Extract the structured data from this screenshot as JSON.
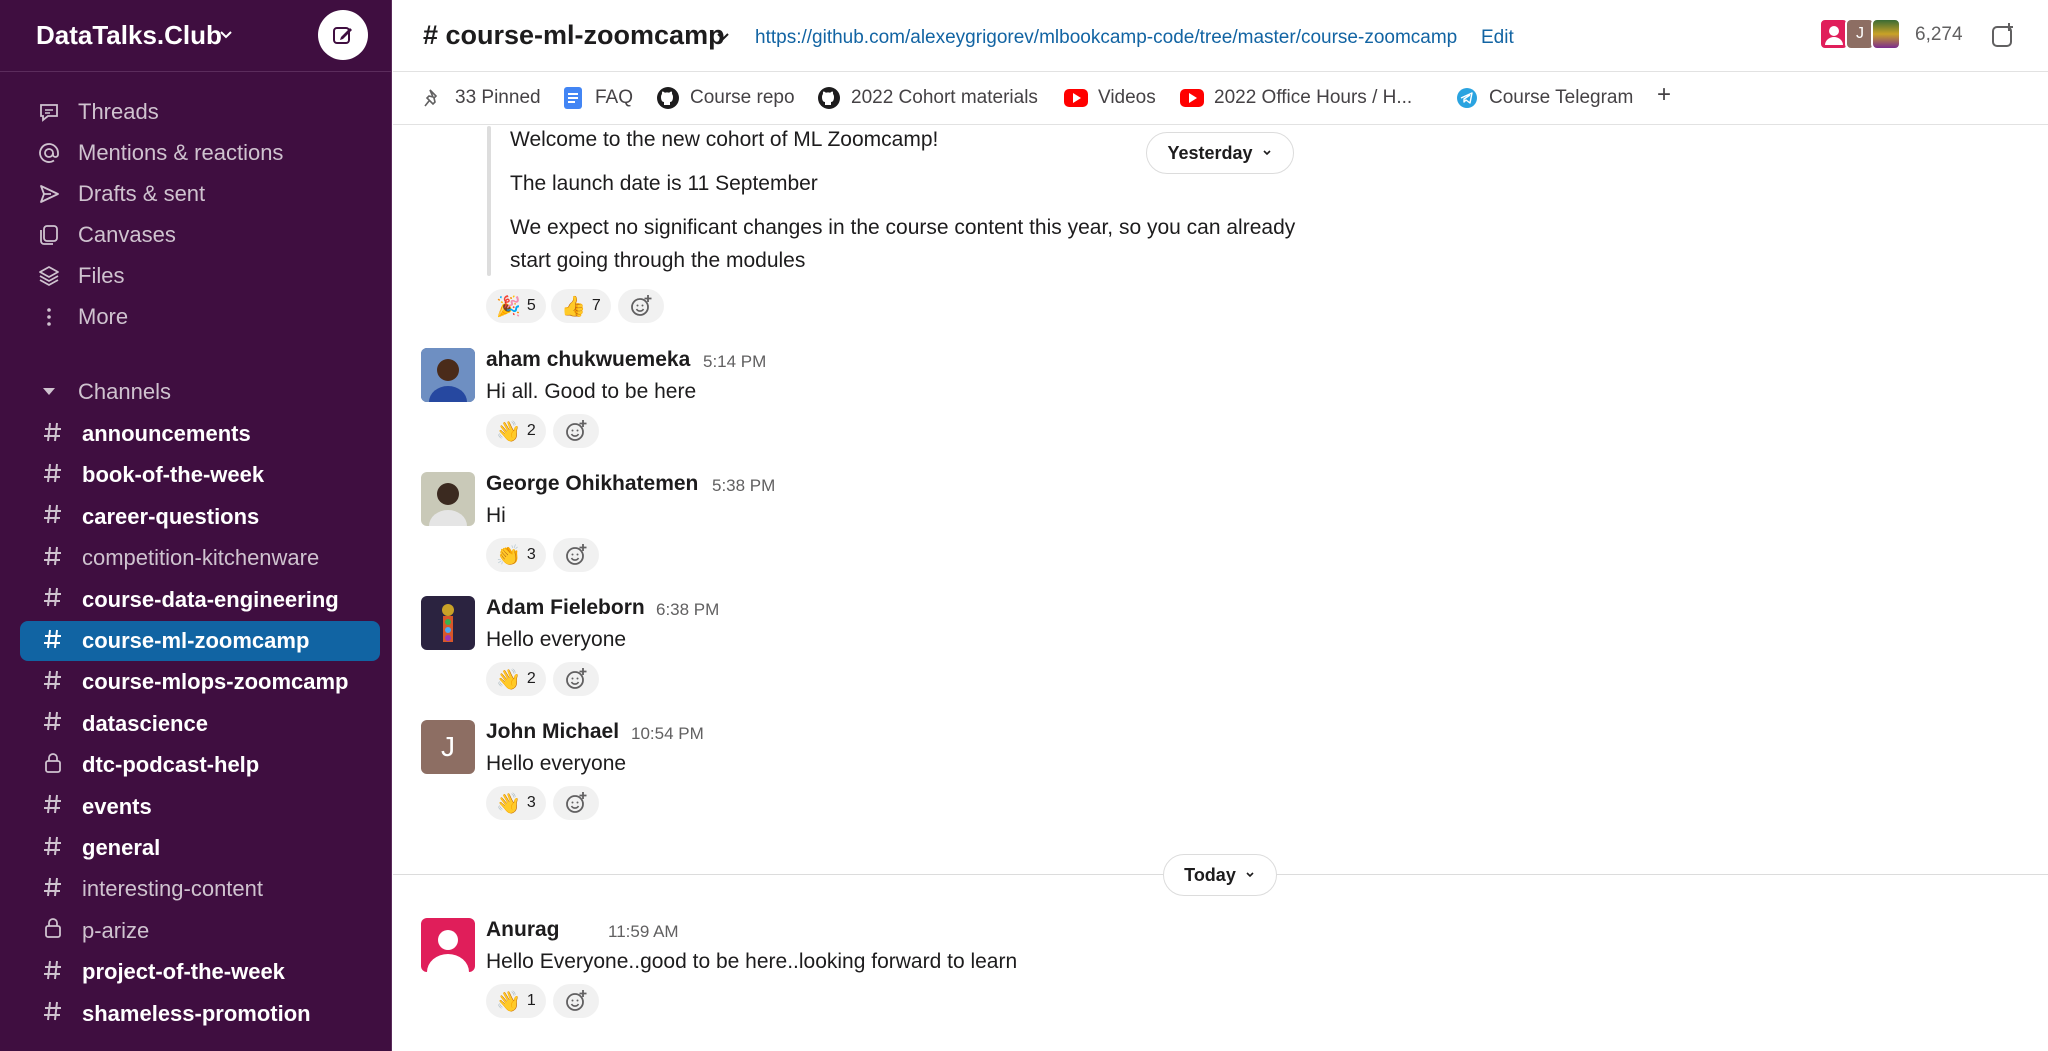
{
  "workspace": {
    "name": "DataTalks.Club"
  },
  "nav": [
    {
      "label": "Threads",
      "icon": "threads-icon"
    },
    {
      "label": "Mentions & reactions",
      "icon": "at-icon"
    },
    {
      "label": "Drafts & sent",
      "icon": "send-icon"
    },
    {
      "label": "Canvases",
      "icon": "canvas-icon"
    },
    {
      "label": "Files",
      "icon": "files-icon"
    },
    {
      "label": "More",
      "icon": "more-icon"
    }
  ],
  "channels_section": {
    "label": "Channels"
  },
  "channels": [
    {
      "name": "announcements",
      "style": "bold",
      "icon": "hash"
    },
    {
      "name": "book-of-the-week",
      "style": "bold",
      "icon": "hash"
    },
    {
      "name": "career-questions",
      "style": "bold",
      "icon": "hash"
    },
    {
      "name": "competition-kitchenware",
      "style": "dim",
      "icon": "hash"
    },
    {
      "name": "course-data-engineering",
      "style": "bold",
      "icon": "hash"
    },
    {
      "name": "course-ml-zoomcamp",
      "style": "active",
      "icon": "hash"
    },
    {
      "name": "course-mlops-zoomcamp",
      "style": "bold",
      "icon": "hash"
    },
    {
      "name": "datascience",
      "style": "bold",
      "icon": "hash"
    },
    {
      "name": "dtc-podcast-help",
      "style": "bold",
      "icon": "lock"
    },
    {
      "name": "events",
      "style": "bold",
      "icon": "hash"
    },
    {
      "name": "general",
      "style": "bold",
      "icon": "hash"
    },
    {
      "name": "interesting-content",
      "style": "dim",
      "icon": "hash"
    },
    {
      "name": "p-arize",
      "style": "dim",
      "icon": "lock"
    },
    {
      "name": "project-of-the-week",
      "style": "bold",
      "icon": "hash"
    },
    {
      "name": "shameless-promotion",
      "style": "bold",
      "icon": "hash"
    }
  ],
  "header": {
    "channel_title": "# course-ml-zoomcamp",
    "topic_link": "https://github.com/alexeygrigorev/mlbookcamp-code/tree/master/course-zoomcamp",
    "edit_label": "Edit",
    "member_count": "6,274",
    "avatar_letter": "J"
  },
  "bookmarks": [
    {
      "label": "33 Pinned",
      "icon": "pin-icon"
    },
    {
      "label": "FAQ",
      "icon": "doc-icon"
    },
    {
      "label": "Course repo",
      "icon": "github-icon"
    },
    {
      "label": "2022 Cohort materials",
      "icon": "github-icon"
    },
    {
      "label": "Videos",
      "icon": "youtube-icon"
    },
    {
      "label": "2022 Office Hours / H...",
      "icon": "youtube-icon"
    },
    {
      "label": "Course Telegram",
      "icon": "telegram-icon"
    },
    {
      "label": "+",
      "icon": "plus-icon"
    }
  ],
  "quoted": {
    "lines": [
      "Welcome to the new cohort of ML Zoomcamp!",
      "The launch date is 11 September",
      "We expect no significant changes in the course content this year, so you can already",
      "start going through the modules"
    ],
    "reactions": [
      {
        "emoji": "🎉",
        "count": "5"
      },
      {
        "emoji": "👍",
        "count": "7"
      }
    ]
  },
  "day_labels": {
    "yesterday": "Yesterday",
    "today": "Today"
  },
  "messages": [
    {
      "name": "aham chukwuemeka",
      "time": "5:14 PM",
      "text": "Hi all. Good to be here",
      "reaction": {
        "emoji": "👋",
        "count": "2"
      }
    },
    {
      "name": "George Ohikhatemen",
      "time": "5:38 PM",
      "text": "Hi",
      "reaction": {
        "emoji": "👏",
        "count": "3"
      }
    },
    {
      "name": "Adam Fieleborn",
      "time": "6:38 PM",
      "text": "Hello everyone",
      "reaction": {
        "emoji": "👋",
        "count": "2"
      }
    },
    {
      "name": "John Michael",
      "time": "10:54 PM",
      "text": "Hello everyone",
      "reaction": {
        "emoji": "👋",
        "count": "3"
      },
      "avatar_letter": "J"
    },
    {
      "name": "Anurag",
      "time": "11:59 AM",
      "text": "Hello Everyone..good to be here..looking forward to learn",
      "reaction": {
        "emoji": "👋",
        "count": "1"
      }
    }
  ],
  "colors": {
    "sidebar": "#3f0e40",
    "active": "#1164a3",
    "link": "#1264a3"
  }
}
